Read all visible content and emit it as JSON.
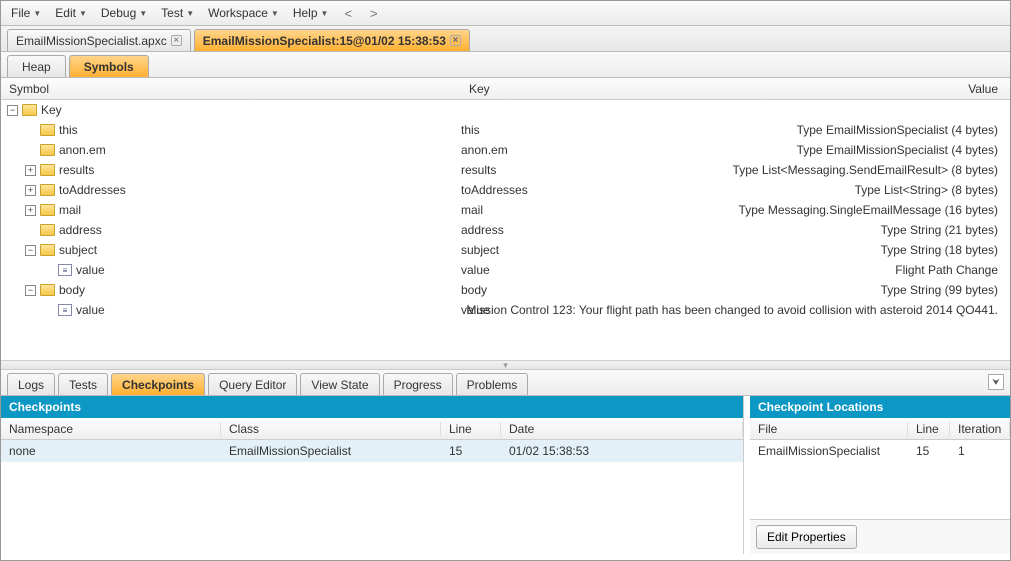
{
  "menu": {
    "file": "File",
    "edit": "Edit",
    "debug": "Debug",
    "test": "Test",
    "workspace": "Workspace",
    "help": "Help",
    "back": "<",
    "fwd": ">"
  },
  "tabs": [
    {
      "label": "EmailMissionSpecialist.apxc",
      "active": false
    },
    {
      "label": "EmailMissionSpecialist:15@01/02 15:38:53",
      "active": true
    }
  ],
  "subtabs": {
    "heap": "Heap",
    "symbols": "Symbols"
  },
  "symtable": {
    "headers": {
      "symbol": "Symbol",
      "key": "Key",
      "value": "Value"
    },
    "rows": [
      {
        "twisty": "minus",
        "icon": "folder",
        "indent": 0,
        "symbol": "Key",
        "key": "",
        "value": ""
      },
      {
        "twisty": "blank",
        "icon": "folder",
        "indent": 1,
        "symbol": "this",
        "key": "this",
        "value": "Type EmailMissionSpecialist (4 bytes)"
      },
      {
        "twisty": "blank",
        "icon": "folder",
        "indent": 1,
        "symbol": "anon.em",
        "key": "anon.em",
        "value": "Type EmailMissionSpecialist (4 bytes)"
      },
      {
        "twisty": "plus",
        "icon": "folder",
        "indent": 1,
        "symbol": "results",
        "key": "results",
        "value": "Type List<Messaging.SendEmailResult> (8 bytes)"
      },
      {
        "twisty": "plus",
        "icon": "folder",
        "indent": 1,
        "symbol": "toAddresses",
        "key": "toAddresses",
        "value": "Type List<String> (8 bytes)"
      },
      {
        "twisty": "plus",
        "icon": "folder",
        "indent": 1,
        "symbol": "mail",
        "key": "mail",
        "value": "Type Messaging.SingleEmailMessage (16 bytes)"
      },
      {
        "twisty": "blank",
        "icon": "folder",
        "indent": 1,
        "symbol": "address",
        "key": "address",
        "value": "Type String (21 bytes)"
      },
      {
        "twisty": "minus",
        "icon": "folder",
        "indent": 1,
        "symbol": "subject",
        "key": "subject",
        "value": "Type String (18 bytes)"
      },
      {
        "twisty": "blank",
        "icon": "value",
        "indent": 2,
        "symbol": "value",
        "key": "value",
        "value": "Flight Path Change"
      },
      {
        "twisty": "minus",
        "icon": "folder",
        "indent": 1,
        "symbol": "body",
        "key": "body",
        "value": "Type String (99 bytes)"
      },
      {
        "twisty": "blank",
        "icon": "value",
        "indent": 2,
        "symbol": "value",
        "key": "value",
        "value": "Mission Control 123: Your flight path has been changed to avoid collision with asteroid 2014 QO441."
      }
    ]
  },
  "bottomtabs": {
    "logs": "Logs",
    "tests": "Tests",
    "checkpoints": "Checkpoints",
    "query": "Query Editor",
    "viewstate": "View State",
    "progress": "Progress",
    "problems": "Problems"
  },
  "checkpoints": {
    "title": "Checkpoints",
    "headers": {
      "namespace": "Namespace",
      "class": "Class",
      "line": "Line",
      "date": "Date"
    },
    "rows": [
      {
        "namespace": "none",
        "class": "EmailMissionSpecialist",
        "line": "15",
        "date": "01/02 15:38:53"
      }
    ]
  },
  "locations": {
    "title": "Checkpoint Locations",
    "headers": {
      "file": "File",
      "line": "Line",
      "iteration": "Iteration"
    },
    "rows": [
      {
        "file": "EmailMissionSpecialist",
        "line": "15",
        "iteration": "1"
      }
    ],
    "edit_button": "Edit Properties"
  }
}
